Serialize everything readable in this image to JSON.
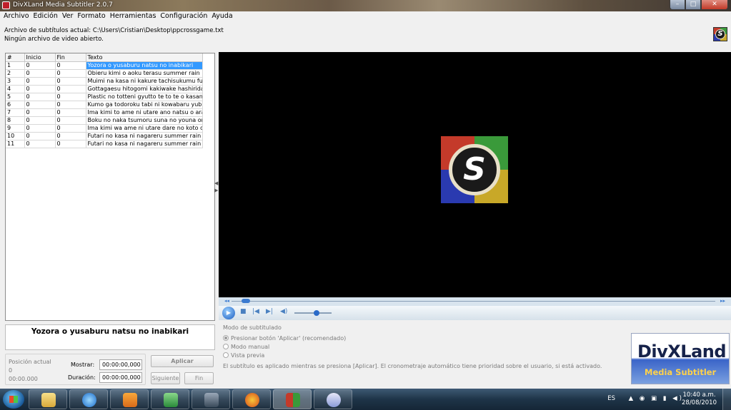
{
  "window": {
    "title": "DivXLand Media Subtitler 2.0.7",
    "min_label": "–",
    "max_label": "□",
    "close_label": "✕"
  },
  "menu": [
    "Archivo",
    "Edición",
    "Ver",
    "Formato",
    "Herramientas",
    "Configuración",
    "Ayuda"
  ],
  "info": {
    "subtitle_file": "Archivo de subtítulos actual: C:\\Users\\Cristian\\Desktop\\ppcrossgame.txt",
    "video_file": "Ningún archivo de video abierto."
  },
  "logo_letter": "S",
  "table": {
    "headers": [
      "#",
      "Inicio",
      "Fin",
      "Texto"
    ],
    "rows": [
      {
        "num": "1",
        "inicio": "0",
        "fin": "0",
        "texto": "Yozora o yusaburu natsu no inabikari"
      },
      {
        "num": "2",
        "inicio": "0",
        "fin": "0",
        "texto": "Obieru kimi o aoku terasu summer rain"
      },
      {
        "num": "3",
        "inicio": "0",
        "fin": "0",
        "texto": "Muimi na kasa ni kakure tachisukumu futari"
      },
      {
        "num": "4",
        "inicio": "0",
        "fin": "0",
        "texto": "Gottagaesu hitogomi kakiwake hashiridasu"
      },
      {
        "num": "5",
        "inicio": "0",
        "fin": "0",
        "texto": "Plastic no totteni gyutto te to te o kasanetet"
      },
      {
        "num": "6",
        "inicio": "0",
        "fin": "0",
        "texto": "Kumo ga todoroku tabi ni kowabaru yubi"
      },
      {
        "num": "7",
        "inicio": "0",
        "fin": "0",
        "texto": "Ima kimi to ame ni utare ano natsu o arai nag"
      },
      {
        "num": "8",
        "inicio": "0",
        "fin": "0",
        "texto": "Boku no naka tsumoru suna no youna omoide"
      },
      {
        "num": "9",
        "inicio": "0",
        "fin": "0",
        "texto": "Ima kimi wa ame ni utare dare no koto omoid"
      },
      {
        "num": "10",
        "inicio": "0",
        "fin": "0",
        "texto": "Futari no kasa ni nagareru summer rain"
      },
      {
        "num": "11",
        "inicio": "0",
        "fin": "0",
        "texto": "Futari no kasa ni nagareru summer rain"
      }
    ],
    "selected_row": 1
  },
  "player": {
    "seek_fraction": 0.02,
    "volume_fraction": 0.6
  },
  "current_subtitle": "Yozora o yusaburu natsu no inabikari",
  "position": {
    "label": "Posición actual",
    "value_line1": "0",
    "value_line2": "00:00.000",
    "mostrar_label": "Mostrar:",
    "mostrar_value": "00:00:00,000",
    "duracion_label": "Duración:",
    "duracion_value": "00:00:00,000"
  },
  "buttons": {
    "aplicar": "Aplicar",
    "siguiente": "Siguiente",
    "fin": "Fin"
  },
  "modes": {
    "header": "Modo de subtitulado",
    "options": [
      "Presionar botón 'Aplicar' (recomendado)",
      "Modo manual",
      "Vista previa"
    ],
    "selected": 0,
    "note": "El subtítulo es aplicado mientras se presiona [Aplicar]. El cronometraje automático tiene prioridad sobre el usuario, si está activado."
  },
  "brand": {
    "line1": "DivXLand",
    "line2": "Media Subtitler"
  },
  "taskbar": {
    "language": "ES",
    "time": "10:40 a.m.",
    "date": "28/08/2010",
    "apps": [
      "folder-icon",
      "ie-icon",
      "media-player-icon",
      "network-icon",
      "starcraft-icon",
      "firefox-icon",
      "subtitler-icon",
      "paint-icon"
    ]
  }
}
